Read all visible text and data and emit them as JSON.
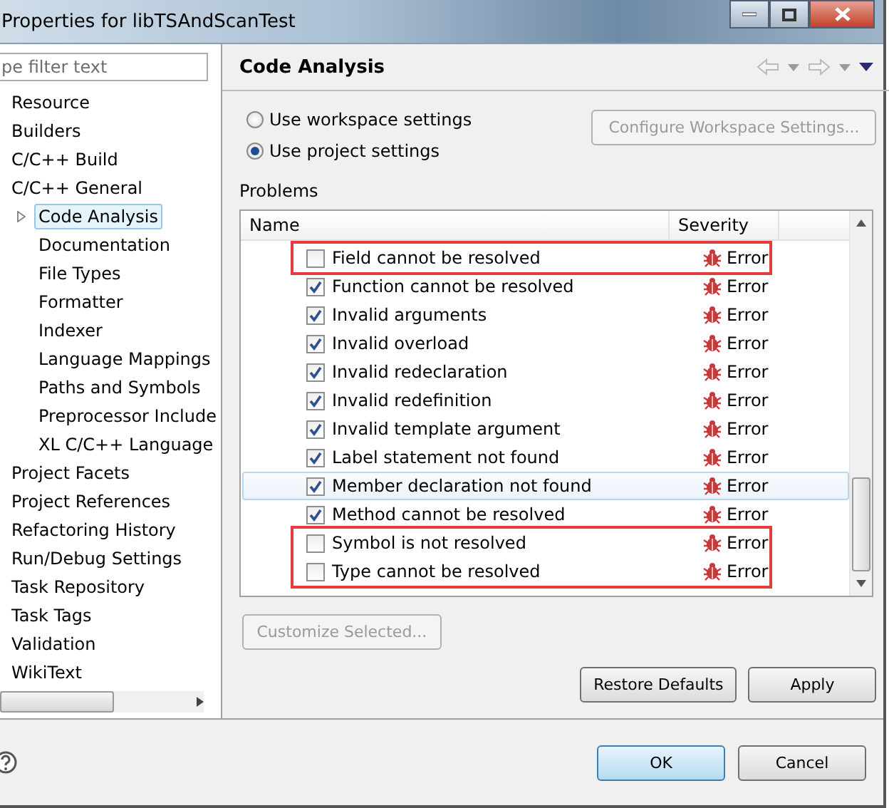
{
  "window": {
    "title": "Properties for libTSAndScanTest"
  },
  "filter": {
    "placeholder": "pe filter text"
  },
  "sidebar": {
    "items": [
      {
        "label": "Resource",
        "selected": false
      },
      {
        "label": "Builders",
        "selected": false
      },
      {
        "label": "C/C++ Build",
        "selected": false
      },
      {
        "label": "C/C++ General",
        "selected": false,
        "children": [
          {
            "label": "Code Analysis",
            "selected": true,
            "expanded": false
          },
          {
            "label": "Documentation",
            "selected": false
          },
          {
            "label": "File Types",
            "selected": false
          },
          {
            "label": "Formatter",
            "selected": false
          },
          {
            "label": "Indexer",
            "selected": false
          },
          {
            "label": "Language Mappings",
            "selected": false
          },
          {
            "label": "Paths and Symbols",
            "selected": false
          },
          {
            "label": "Preprocessor Include",
            "selected": false
          },
          {
            "label": "XL C/C++ Language",
            "selected": false
          }
        ]
      },
      {
        "label": "Project Facets",
        "selected": false
      },
      {
        "label": "Project References",
        "selected": false
      },
      {
        "label": "Refactoring History",
        "selected": false
      },
      {
        "label": "Run/Debug Settings",
        "selected": false
      },
      {
        "label": "Task Repository",
        "selected": false
      },
      {
        "label": "Task Tags",
        "selected": false
      },
      {
        "label": "Validation",
        "selected": false
      },
      {
        "label": "WikiText",
        "selected": false
      }
    ]
  },
  "page": {
    "title": "Code Analysis",
    "settings": [
      {
        "label": "Use workspace settings",
        "selected": false
      },
      {
        "label": "Use project settings",
        "selected": true
      }
    ],
    "configure_button": {
      "label": "Configure Workspace Settings...",
      "disabled": true
    },
    "problems_label": "Problems",
    "table": {
      "columns": [
        "Name",
        "Severity"
      ],
      "rows": [
        {
          "name": "Field cannot be resolved",
          "checked": false,
          "severity": "Error",
          "selected": false,
          "highlighted": true
        },
        {
          "name": "Function cannot be resolved",
          "checked": true,
          "severity": "Error",
          "selected": false,
          "highlighted": false
        },
        {
          "name": "Invalid arguments",
          "checked": true,
          "severity": "Error",
          "selected": false,
          "highlighted": false
        },
        {
          "name": "Invalid overload",
          "checked": true,
          "severity": "Error",
          "selected": false,
          "highlighted": false
        },
        {
          "name": "Invalid redeclaration",
          "checked": true,
          "severity": "Error",
          "selected": false,
          "highlighted": false
        },
        {
          "name": "Invalid redefinition",
          "checked": true,
          "severity": "Error",
          "selected": false,
          "highlighted": false
        },
        {
          "name": "Invalid template argument",
          "checked": true,
          "severity": "Error",
          "selected": false,
          "highlighted": false
        },
        {
          "name": "Label statement not found",
          "checked": true,
          "severity": "Error",
          "selected": false,
          "highlighted": false
        },
        {
          "name": "Member declaration not found",
          "checked": true,
          "severity": "Error",
          "selected": true,
          "highlighted": false
        },
        {
          "name": "Method cannot be resolved",
          "checked": true,
          "severity": "Error",
          "selected": false,
          "highlighted": false
        },
        {
          "name": "Symbol is not resolved",
          "checked": false,
          "severity": "Error",
          "selected": false,
          "highlighted": true
        },
        {
          "name": "Type cannot be resolved",
          "checked": false,
          "severity": "Error",
          "selected": false,
          "highlighted": true
        }
      ]
    },
    "customize_button": {
      "label": "Customize Selected...",
      "disabled": true
    },
    "buttons": [
      {
        "label": "Restore Defaults"
      },
      {
        "label": "Apply"
      }
    ]
  },
  "dialog_buttons": [
    {
      "label": "OK",
      "selected": true
    },
    {
      "label": "Cancel",
      "selected": false
    }
  ]
}
